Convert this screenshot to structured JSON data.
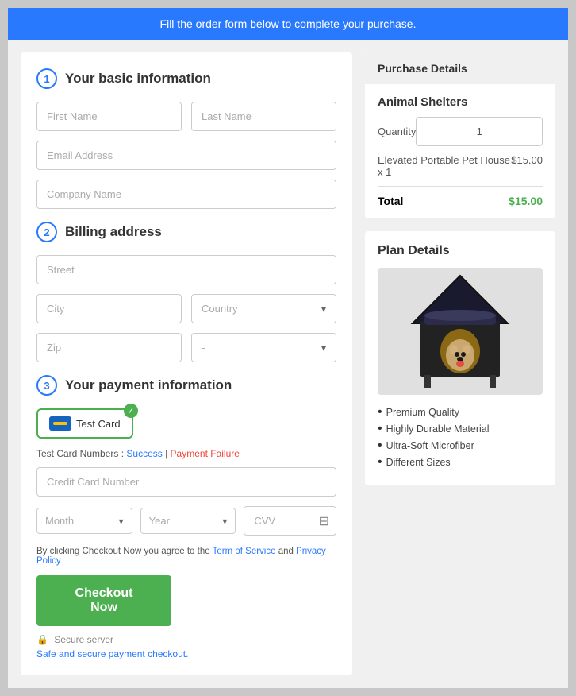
{
  "banner": {
    "text": "Fill the order form below to complete your purchase."
  },
  "sections": {
    "basic_info": {
      "step": "1",
      "title": "Your basic information"
    },
    "billing": {
      "step": "2",
      "title": "Billing address"
    },
    "payment": {
      "step": "3",
      "title": "Your payment information"
    }
  },
  "form": {
    "first_name_placeholder": "First Name",
    "last_name_placeholder": "Last Name",
    "email_placeholder": "Email Address",
    "company_placeholder": "Company Name",
    "street_placeholder": "Street",
    "city_placeholder": "City",
    "country_placeholder": "Country",
    "zip_placeholder": "Zip",
    "state_placeholder": "-",
    "card_label": "Test Card",
    "test_card_label": "Test Card Numbers :",
    "success_link": "Success",
    "failure_link": "Payment Failure",
    "cc_placeholder": "Credit Card Number",
    "month_placeholder": "Month",
    "year_placeholder": "Year",
    "cvv_placeholder": "CVV",
    "terms_text_prefix": "By clicking Checkout Now you agree to the",
    "terms_link": "Term of Service",
    "privacy_link": "Privacy Policy",
    "terms_connector": "and",
    "checkout_label": "Checkout Now",
    "secure_label": "Secure server",
    "safe_label": "Safe and secure payment checkout."
  },
  "purchase_details": {
    "header": "Purchase Details",
    "product_title": "Animal Shelters",
    "quantity_label": "Quantity",
    "quantity_value": "1",
    "item_name": "Elevated Portable Pet House x 1",
    "item_price": "$15.00",
    "total_label": "Total",
    "total_value": "$15.00"
  },
  "plan_details": {
    "title": "Plan Details",
    "features": [
      "Premium Quality",
      "Highly Durable Material",
      "Ultra-Soft Microfiber",
      "Different Sizes"
    ]
  }
}
